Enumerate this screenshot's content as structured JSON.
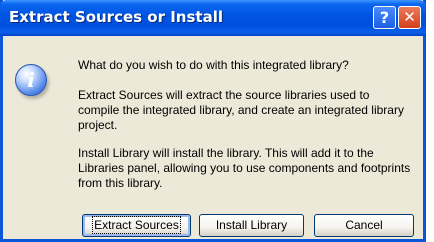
{
  "dialog": {
    "title": "Extract Sources or Install",
    "help_button": "?",
    "close_button": "✕",
    "icon": "information-icon",
    "question": "What do you wish to do with this integrated library?",
    "extract_description": "Extract Sources will extract the source libraries used to compile the integrated library, and create an integrated library project.",
    "install_description": "Install Library will install the library. This will add it to the Libraries panel, allowing you to use components and footprints from this library.",
    "buttons": {
      "extract_sources": "Extract Sources",
      "install_library": "Install Library",
      "cancel": "Cancel"
    },
    "colors": {
      "titlebar": "#0053e1",
      "body": "#ece9d8",
      "close": "#d2401c"
    }
  }
}
